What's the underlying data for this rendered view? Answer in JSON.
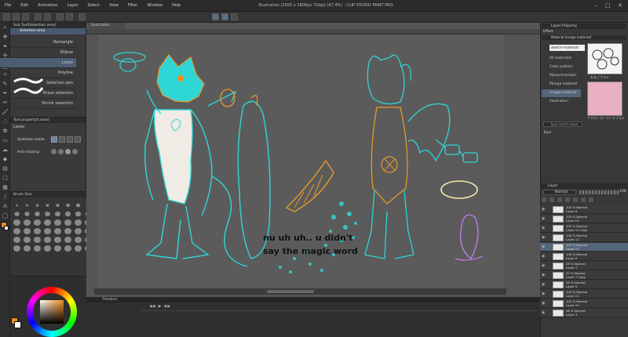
{
  "window": {
    "title": "Illustration (2500 x 1800px 72dpi) (47.4%) - CLIP STUDIO PAINT PRO"
  },
  "menu": [
    "File",
    "Edit",
    "Animation",
    "Layer",
    "Select",
    "View",
    "Filter",
    "Window",
    "Help"
  ],
  "subtool": {
    "header": "Sub Tool[Selection area]",
    "group": "Selection area",
    "items": [
      {
        "label": "Rectangle"
      },
      {
        "label": "Ellipse"
      },
      {
        "label": "Lasso",
        "selected": true
      },
      {
        "label": "Polyline"
      },
      {
        "label": "Selection pen"
      },
      {
        "label": "Erase selection"
      },
      {
        "label": "Shrink selection"
      }
    ]
  },
  "tool_property": {
    "header": "Tool property[Lasso]",
    "name": "Lasso",
    "selection_mode_label": "Selection mode",
    "antialiasing_label": "Anti-aliasing"
  },
  "brush_size": {
    "header": "Brush Size"
  },
  "document": {
    "tab": "Illustration"
  },
  "artwork": {
    "line1": "nu uh uh.. u didn't",
    "line2": "say the magic word"
  },
  "timeline": {
    "header": "Timeline"
  },
  "material": {
    "header": "Layer Property",
    "tab": "Effect",
    "subheader": "Material [Image material]",
    "search_value": "sketch+materials",
    "items": [
      {
        "label": "All materials"
      },
      {
        "label": "Color pattern"
      },
      {
        "label": "Monochromatic"
      },
      {
        "label": "Manga material"
      },
      {
        "label": "Image material",
        "selected": true
      },
      {
        "label": "Illustration"
      }
    ],
    "thumb_caption_1": "丸をごブラシ",
    "thumb_caption_2": "フクローガーランドブラシ",
    "search_placeholder": "Type search keyw",
    "type_label": "Type"
  },
  "layers": {
    "header": "Layer",
    "blend": "Normal",
    "opacity": "100",
    "items": [
      {
        "mode": "100 % Normal",
        "name": "Layer 8"
      },
      {
        "mode": "100 % Normal",
        "name": "Layer F4"
      },
      {
        "mode": "100 % Normal",
        "name": "Layer 12 Copy"
      },
      {
        "mode": "100 % Normal",
        "name": "Layer 12"
      },
      {
        "mode": "100 % Normal",
        "name": "Layer 13",
        "selected": true
      },
      {
        "mode": "100 % Normal",
        "name": "Layer 5"
      },
      {
        "mode": "26 % Normal",
        "name": "Layer 7"
      },
      {
        "mode": "20 % Normal",
        "name": "Layer 7 Copy"
      },
      {
        "mode": "36 % Normal",
        "name": "Layer 9"
      },
      {
        "mode": "100 % Normal",
        "name": "Layer 11"
      },
      {
        "mode": "100 % Normal",
        "name": "Layer 10"
      },
      {
        "mode": "48 % Normal",
        "name": "Layer 3"
      }
    ]
  },
  "colors": {
    "accent": "#f28c1e",
    "teal": "#2fd6d6",
    "selection": "#55657a"
  }
}
